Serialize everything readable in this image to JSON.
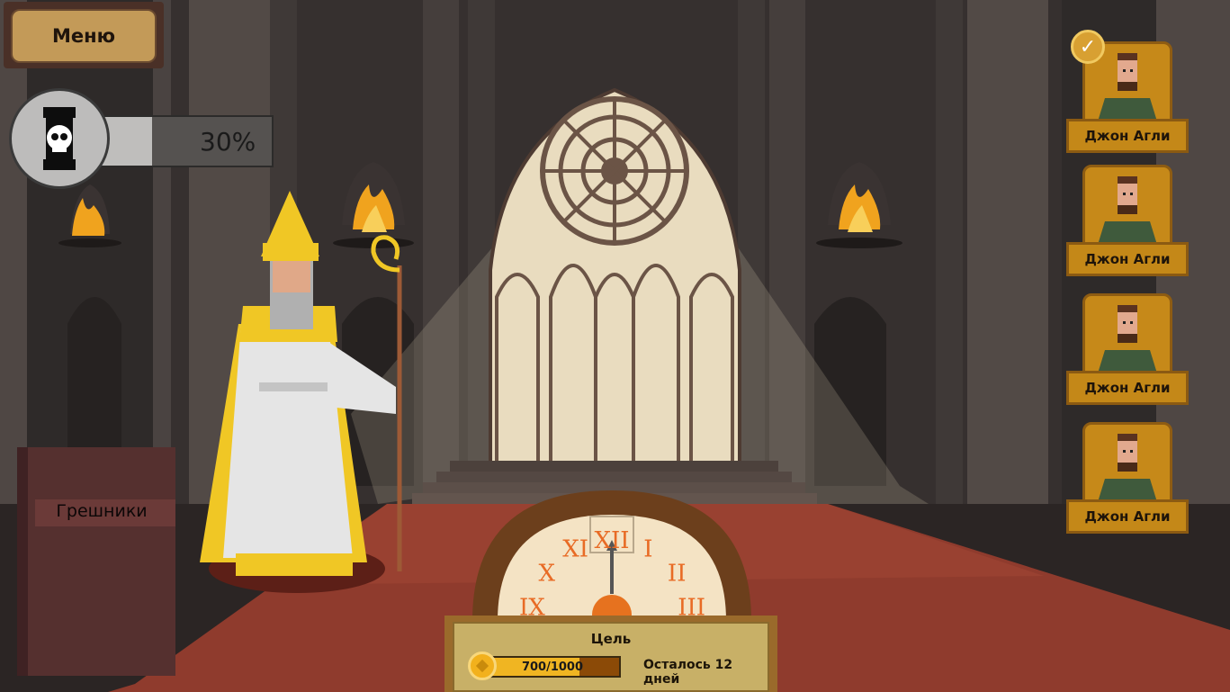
{
  "menu": {
    "label": "Меню"
  },
  "danger_meter": {
    "percent_label": "30%",
    "level": 0.3,
    "icon": "skull-icon"
  },
  "sinners_book": {
    "label": "Грешники"
  },
  "characters": [
    {
      "name": "Джон Агли",
      "selected": true
    },
    {
      "name": "Джон Агли",
      "selected": false
    },
    {
      "name": "Джон Агли",
      "selected": false
    },
    {
      "name": "Джон Агли",
      "selected": false
    }
  ],
  "goal": {
    "title": "Цель",
    "progress_label": "700/1000",
    "progress": 0.7,
    "days_left": "Осталось 12 дней",
    "icon": "coin-icon"
  },
  "clock": {
    "numerals": [
      "IX",
      "X",
      "XI",
      "XII",
      "I",
      "II",
      "III"
    ]
  },
  "colors": {
    "carpet": "#8f3b2d",
    "wall": "#3a3433",
    "gold": "#c68919",
    "window": "#e9dcbf"
  }
}
